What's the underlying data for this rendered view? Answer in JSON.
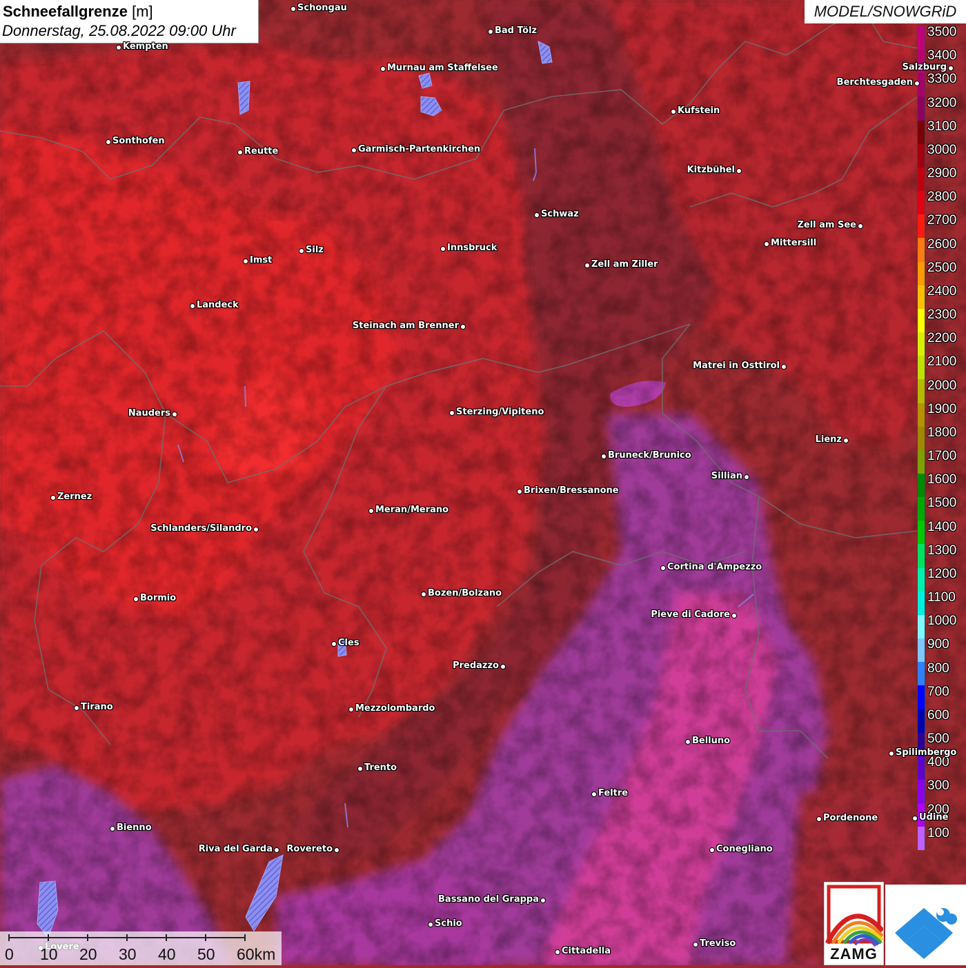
{
  "header": {
    "title_bold": "Schneefallgrenze",
    "title_unit": "[m]",
    "date": "Donnerstag, 25.08.2022 09:00 Uhr",
    "model": "MODEL/SNOWGRiD"
  },
  "legend": {
    "labels": [
      "3500",
      "3400",
      "3300",
      "3200",
      "3100",
      "3000",
      "2900",
      "2800",
      "2700",
      "2600",
      "2500",
      "2400",
      "2300",
      "2200",
      "2100",
      "2000",
      "1900",
      "1800",
      "1700",
      "1600",
      "1500",
      "1400",
      "1300",
      "1200",
      "1100",
      "1000",
      "900",
      "800",
      "700",
      "600",
      "500",
      "400",
      "300",
      "200",
      "100"
    ],
    "colors": [
      "#c2007a",
      "#b8006f",
      "#a8006a",
      "#8e0060",
      "#7a0008",
      "#a00010",
      "#c00010",
      "#e00012",
      "#ff1a10",
      "#ff7a10",
      "#ff9a00",
      "#ffbf00",
      "#ffff00",
      "#d8f000",
      "#c0e000",
      "#b8b800",
      "#b89000",
      "#a08800",
      "#80a000",
      "#008a00",
      "#00a800",
      "#00c800",
      "#00e060",
      "#00f0b0",
      "#00f0e0",
      "#80f8ff",
      "#80c8ff",
      "#3080ff",
      "#0000ff",
      "#0000b0",
      "#300090",
      "#6000c8",
      "#8a00e8",
      "#b000f0",
      "#c060ff"
    ]
  },
  "scale": {
    "labels": [
      "0",
      "10",
      "20",
      "30",
      "40",
      "50",
      "60km"
    ]
  },
  "logos": {
    "zamg_text": "ZAMG"
  },
  "cities": [
    {
      "name": "Schongau",
      "side": "r"
    },
    {
      "name": "Bad Tölz",
      "side": "r"
    },
    {
      "name": "Kempten",
      "side": "r"
    },
    {
      "name": "Murnau am Staffelsee",
      "side": "r"
    },
    {
      "name": "Berchtesgaden",
      "side": "l"
    },
    {
      "name": "Kufstein",
      "side": "r"
    },
    {
      "name": "Sonthofen",
      "side": "r"
    },
    {
      "name": "Reutte",
      "side": "r"
    },
    {
      "name": "Garmisch-Partenkirchen",
      "side": "r"
    },
    {
      "name": "Kitzbühel",
      "side": "l"
    },
    {
      "name": "Schwaz",
      "side": "r"
    },
    {
      "name": "Zell am See",
      "side": "l"
    },
    {
      "name": "Mittersill",
      "side": "r"
    },
    {
      "name": "Innsbruck",
      "side": "r"
    },
    {
      "name": "Silz",
      "side": "r"
    },
    {
      "name": "Imst",
      "side": "r"
    },
    {
      "name": "Zell am Ziller",
      "side": "r"
    },
    {
      "name": "Landeck",
      "side": "r"
    },
    {
      "name": "Steinach am Brenner",
      "side": "l"
    },
    {
      "name": "Matrei in Osttirol",
      "side": "l"
    },
    {
      "name": "Nauders",
      "side": "l"
    },
    {
      "name": "Sterzing/Vipiteno",
      "side": "r"
    },
    {
      "name": "Lienz",
      "side": "l"
    },
    {
      "name": "Bruneck/Brunico",
      "side": "r"
    },
    {
      "name": "Sillian",
      "side": "l"
    },
    {
      "name": "Brixen/Bressanone",
      "side": "r"
    },
    {
      "name": "Zernez",
      "side": "r"
    },
    {
      "name": "Meran/Merano",
      "side": "r"
    },
    {
      "name": "Schlanders/Silandro",
      "side": "l"
    },
    {
      "name": "Cortina d'Ampezzo",
      "side": "r"
    },
    {
      "name": "Bozen/Bolzano",
      "side": "r"
    },
    {
      "name": "Bormio",
      "side": "r"
    },
    {
      "name": "Pieve di Cadore",
      "side": "l"
    },
    {
      "name": "Cles",
      "side": "r"
    },
    {
      "name": "Predazzo",
      "side": "l"
    },
    {
      "name": "Tirano",
      "side": "r"
    },
    {
      "name": "Mezzolombardo",
      "side": "r"
    },
    {
      "name": "Belluno",
      "side": "r"
    },
    {
      "name": "Spilimbergo",
      "side": "r"
    },
    {
      "name": "Trento",
      "side": "r"
    },
    {
      "name": "Feltre",
      "side": "r"
    },
    {
      "name": "Pordenone",
      "side": "r"
    },
    {
      "name": "Bienno",
      "side": "r"
    },
    {
      "name": "Riva del Garda",
      "side": "l"
    },
    {
      "name": "Rovereto",
      "side": "l"
    },
    {
      "name": "Conegliano",
      "side": "r"
    },
    {
      "name": "Bassano del Grappa",
      "side": "l"
    },
    {
      "name": "Schio",
      "side": "r"
    },
    {
      "name": "Treviso",
      "side": "r"
    },
    {
      "name": "Cittadella",
      "side": "r"
    },
    {
      "name": "Salzburg",
      "side": "l"
    },
    {
      "name": "Udine",
      "side": "r"
    },
    {
      "name": "Lovere",
      "side": "r"
    }
  ]
}
